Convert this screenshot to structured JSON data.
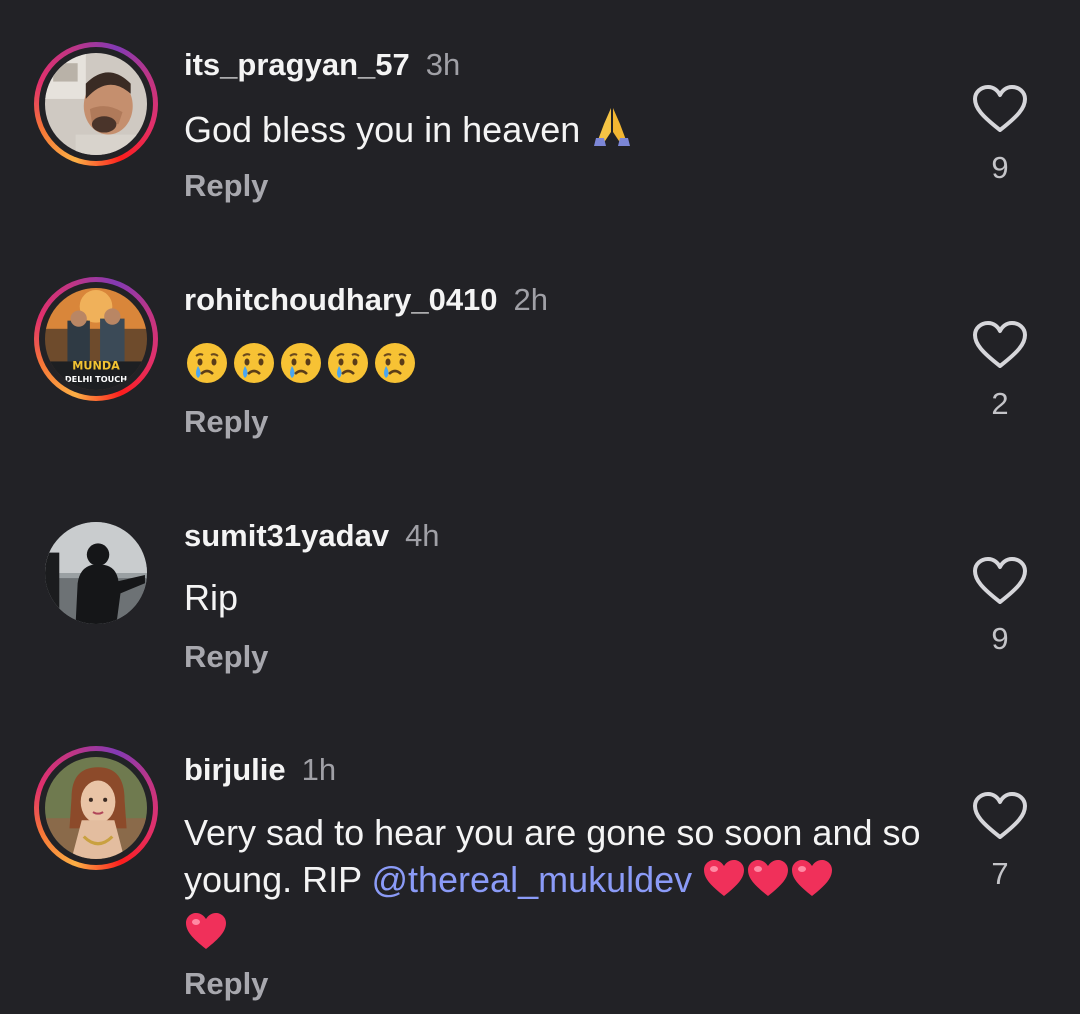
{
  "comments": [
    {
      "username": "its_pragyan_57",
      "time": "3h",
      "text": "God bless you in heaven",
      "emoji": "folded-hands",
      "reply_label": "Reply",
      "likes": "9"
    },
    {
      "username": "rohitchoudhary_0410",
      "time": "2h",
      "text": "",
      "emoji": "crying-face x5",
      "avatar_text_1": "MUNDA",
      "avatar_text_2": "DELHI TOUCH",
      "reply_label": "Reply",
      "likes": "2"
    },
    {
      "username": "sumit31yadav",
      "time": "4h",
      "text": "Rip",
      "reply_label": "Reply",
      "likes": "9"
    },
    {
      "username": "birjulie",
      "time": "1h",
      "text_before": "Very sad to hear you are gone so soon and so young. RIP ",
      "mention": "@thereal_mukuldev",
      "emoji": "red-heart x4",
      "reply_label": "Reply",
      "likes": "7"
    }
  ],
  "colors": {
    "background": "#222226",
    "mention": "#8b9bf7",
    "secondary_text": "#a0a0a6"
  },
  "icons": {
    "like": "heart-outline-icon"
  }
}
